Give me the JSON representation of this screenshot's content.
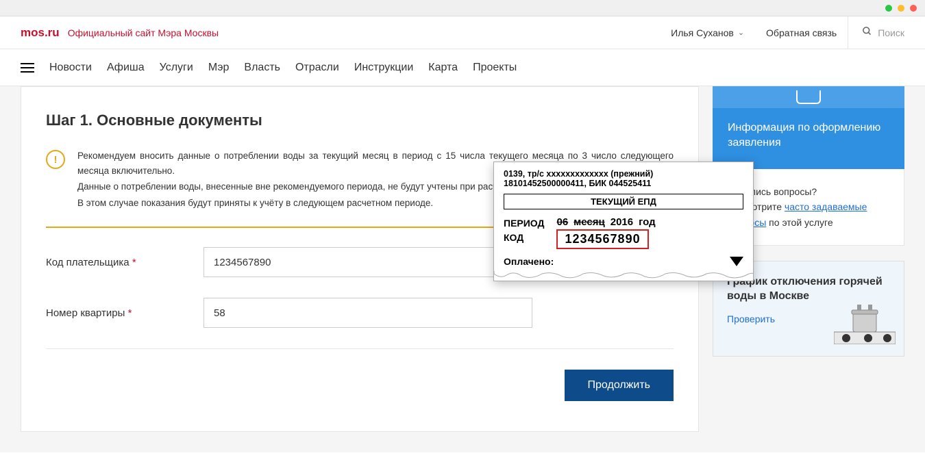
{
  "browser": {},
  "header": {
    "logo": "mos.ru",
    "tagline": "Официальный сайт Мэра Москвы",
    "user_name": "Илья Суханов",
    "feedback": "Обратная связь",
    "search_placeholder": "Поиск"
  },
  "nav": {
    "items": [
      "Новости",
      "Афиша",
      "Услуги",
      "Мэр",
      "Власть",
      "Отрасли",
      "Инструкции",
      "Карта",
      "Проекты"
    ]
  },
  "form": {
    "step_title": "Шаг 1. Основные документы",
    "notice_p1": "Рекомендуем вносить данные о потреблении воды за текущий месяц в период с 15 числа текущего месяца по 3 число следующего месяца включительно.",
    "notice_p2": "Данные о потреблении воды, внесенные вне рекомендуемого периода, не будут учтены при расчете начислений текущего периода.",
    "notice_p3": "В этом случае показания будут приняты к учёту в следующем расчетном периоде.",
    "payer_code_label": "Код плательщика",
    "payer_code_value": "1234567890",
    "apt_label": "Номер квартиры",
    "apt_value": "58",
    "submit_label": "Продолжить"
  },
  "sidebar": {
    "info_title": "Информация по оформлению заявления",
    "faq_text1": "Остались вопросы?",
    "faq_text2": "Посмотрите ",
    "faq_link": "часто задаваемые вопросы",
    "faq_text3": " по этой услуге",
    "promo_title": "График отключения горячей воды в Москве",
    "promo_link": "Проверить"
  },
  "doc_hint": {
    "line1": "0139, тр/с xxxxxxxxxxxxx (прежний)",
    "line2": "18101452500000411, БИК 044525411",
    "banner": "ТЕКУЩИЙ ЕПД",
    "label_period": "ПЕРИОД",
    "label_code": "КОД",
    "period_month": "06",
    "period_month_word": "месяц",
    "period_year": "2016",
    "period_year_word": "год",
    "code_value": "1234567890",
    "paid_label": "Оплачено:"
  }
}
